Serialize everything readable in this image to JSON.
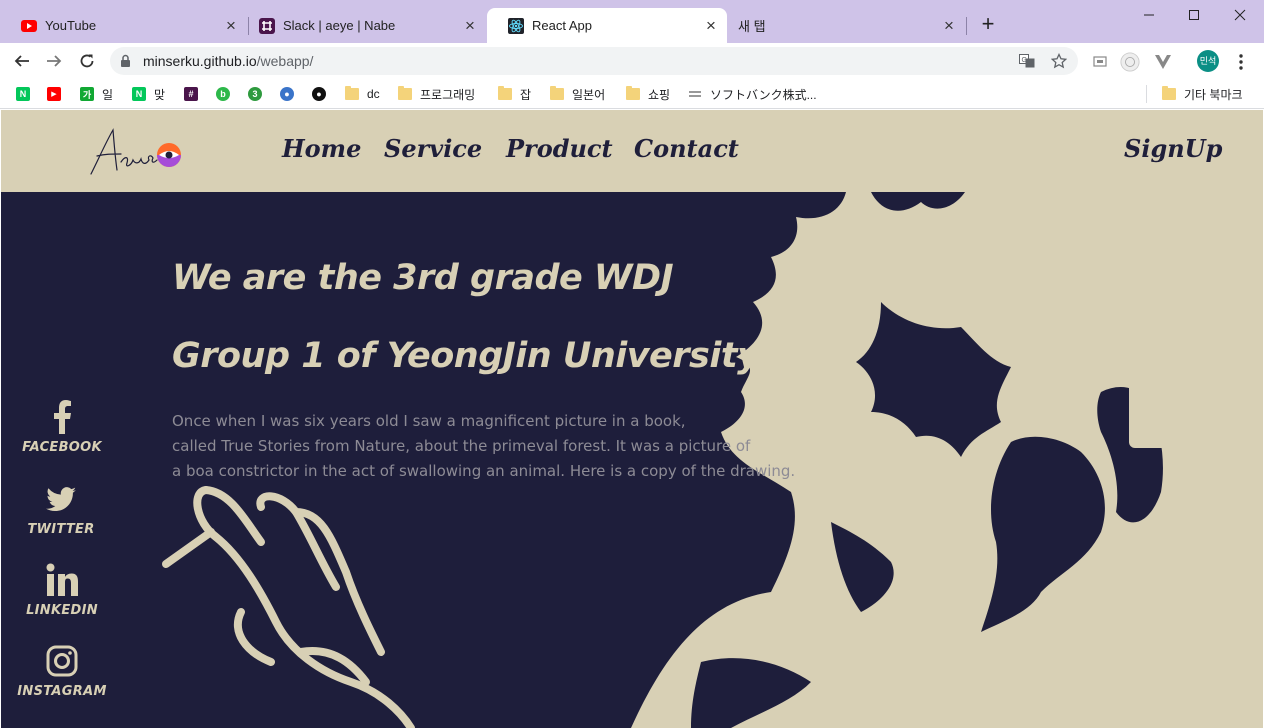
{
  "browser": {
    "tabs": [
      {
        "title": "YouTube",
        "favicon": "youtube-icon",
        "active": false
      },
      {
        "title": "Slack | aeye | Nabe",
        "favicon": "slack-icon",
        "active": false
      },
      {
        "title": "React App",
        "favicon": "react-icon",
        "active": true
      },
      {
        "title": "새 탭",
        "favicon": "none",
        "active": false
      }
    ],
    "url_host": "minserku.github.io",
    "url_path": "/webapp/",
    "profile_initials": "민석",
    "bookmarks": [
      {
        "label": "",
        "icon": "naver-icon",
        "color": "#03c75a",
        "glyph": "N"
      },
      {
        "label": "",
        "icon": "youtube-icon",
        "color": "#ff0000",
        "glyph": "▶"
      },
      {
        "label": "일",
        "icon": "game-icon",
        "color": "#11a833",
        "glyph": "가"
      },
      {
        "label": "맞",
        "icon": "naver-icon",
        "color": "#03c75a",
        "glyph": "N"
      },
      {
        "label": "",
        "icon": "slack-icon",
        "color": "#4a154b",
        "glyph": "#"
      },
      {
        "label": "",
        "icon": "b-icon",
        "color": "#2db84a",
        "glyph": "b"
      },
      {
        "label": "",
        "icon": "green-circle-icon",
        "color": "#2e9a3e",
        "glyph": "3"
      },
      {
        "label": "",
        "icon": "blue-circle-icon",
        "color": "#3a74c9",
        "glyph": "●"
      },
      {
        "label": "",
        "icon": "github-icon",
        "color": "#111111",
        "glyph": "●"
      },
      {
        "label": "dc",
        "icon": "folder-icon"
      },
      {
        "label": "프로그래밍",
        "icon": "folder-icon"
      },
      {
        "label": "잡",
        "icon": "folder-icon"
      },
      {
        "label": "일본어",
        "icon": "folder-icon"
      },
      {
        "label": "쇼핑",
        "icon": "folder-icon"
      },
      {
        "label": "ソフトバンク株式...",
        "icon": "softbank-icon"
      }
    ],
    "other_bookmarks": "기타 북마크"
  },
  "site": {
    "nav": [
      "Home",
      "Service",
      "Product",
      "Contact"
    ],
    "signup": "SignUp",
    "headline_1": "We are the 3rd grade WDJ",
    "headline_2": "Group 1 of YeongJin University.",
    "body": [
      "Once when I was six years old I saw a magnificent picture in a book,",
      "called True Stories from Nature, about the primeval forest. It was a picture of",
      "a boa constrictor in the act of swallowing an animal. Here is a copy of the drawing."
    ],
    "social": [
      "FACEBOOK",
      "TWITTER",
      "LINKEDIN",
      "INSTAGRAM"
    ],
    "colors": {
      "header_bg": "#d8d0b5",
      "hero_bg": "#1e1e3b",
      "accent": "#d8d0b5",
      "nav_text": "#1f1f3a"
    }
  }
}
